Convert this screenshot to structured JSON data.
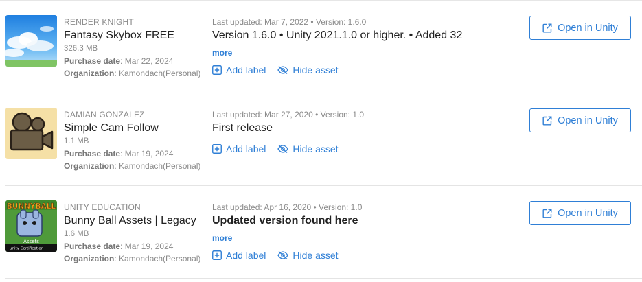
{
  "assets": [
    {
      "publisher": "RENDER KNIGHT",
      "title": "Fantasy Skybox FREE",
      "size": "326.3 MB",
      "purchase_label": "Purchase date",
      "purchase_value": ": Mar 22, 2024",
      "org_label": "Organization",
      "org_value": ": Kamondach(Personal)",
      "updated": "Last updated: Mar 7, 2022 • Version: 1.6.0",
      "description": "Version 1.6.0 • Unity 2021.1.0 or higher. • Added 32",
      "more": "more",
      "add_label": "Add label",
      "hide_asset": "Hide asset",
      "open_button": "Open in Unity",
      "thumb_icon": "sky-clouds-thumbnail"
    },
    {
      "publisher": "DAMIAN GONZALEZ",
      "title": "Simple Cam Follow",
      "size": "1.1 MB",
      "purchase_label": "Purchase date",
      "purchase_value": ": Mar 19, 2024",
      "org_label": "Organization",
      "org_value": ": Kamondach(Personal)",
      "updated": "Last updated: Mar 27, 2020 • Version: 1.0",
      "description": "First release",
      "add_label": "Add label",
      "hide_asset": "Hide asset",
      "open_button": "Open in Unity",
      "thumb_icon": "video-camera-thumbnail"
    },
    {
      "publisher": "UNITY EDUCATION",
      "title": "Bunny Ball Assets | Legacy",
      "size": "1.6 MB",
      "purchase_label": "Purchase date",
      "purchase_value": ": Mar 19, 2024",
      "org_label": "Organization",
      "org_value": ": Kamondach(Personal)",
      "updated": "Last updated: Apr 16, 2020 • Version: 1.0",
      "description": "Updated version found here",
      "more": "more",
      "add_label": "Add label",
      "hide_asset": "Hide asset",
      "open_button": "Open in Unity",
      "thumb_icon": "bunny-ball-thumbnail",
      "thumb_text_top": "BUNNYBALL",
      "thumb_text_mid": "Assets",
      "thumb_text_badge": "unity Certification"
    }
  ],
  "colors": {
    "link": "#2f7fd6",
    "muted": "#8a8a8a",
    "text": "#212121"
  }
}
